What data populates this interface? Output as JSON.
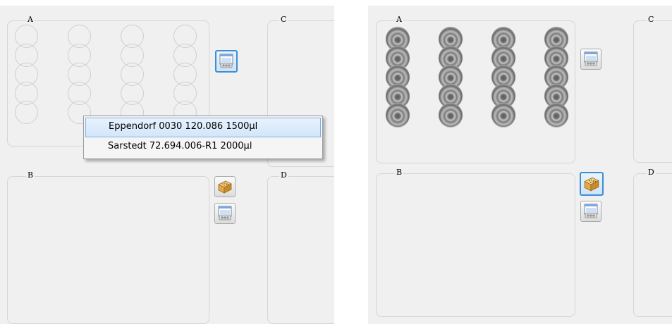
{
  "left_panel": {
    "groups": {
      "a": "A",
      "b": "B",
      "c": "C",
      "d": "D"
    },
    "context_menu": {
      "items": [
        {
          "label": "Eppendorf 0030 120.086  1500µl",
          "highlighted": true
        },
        {
          "label": "Sarstedt 72.694.006-R1 2000µl",
          "highlighted": false
        }
      ]
    },
    "rack_a": {
      "rows": 5,
      "cols": 4,
      "state": "empty"
    }
  },
  "right_panel": {
    "groups": {
      "a": "A",
      "b": "B",
      "c": "C",
      "d": "D"
    },
    "rack_a": {
      "rows": 5,
      "cols": 4,
      "state": "filled"
    }
  },
  "icons": {
    "tube_rack": "tube-rack-icon",
    "tip_box": "tip-box-icon"
  },
  "colors": {
    "panel_bg": "#f0f0f0",
    "group_border": "#d5d5d5",
    "highlight_border": "#7fb1e6",
    "active_button_border": "#3c8fd4"
  }
}
